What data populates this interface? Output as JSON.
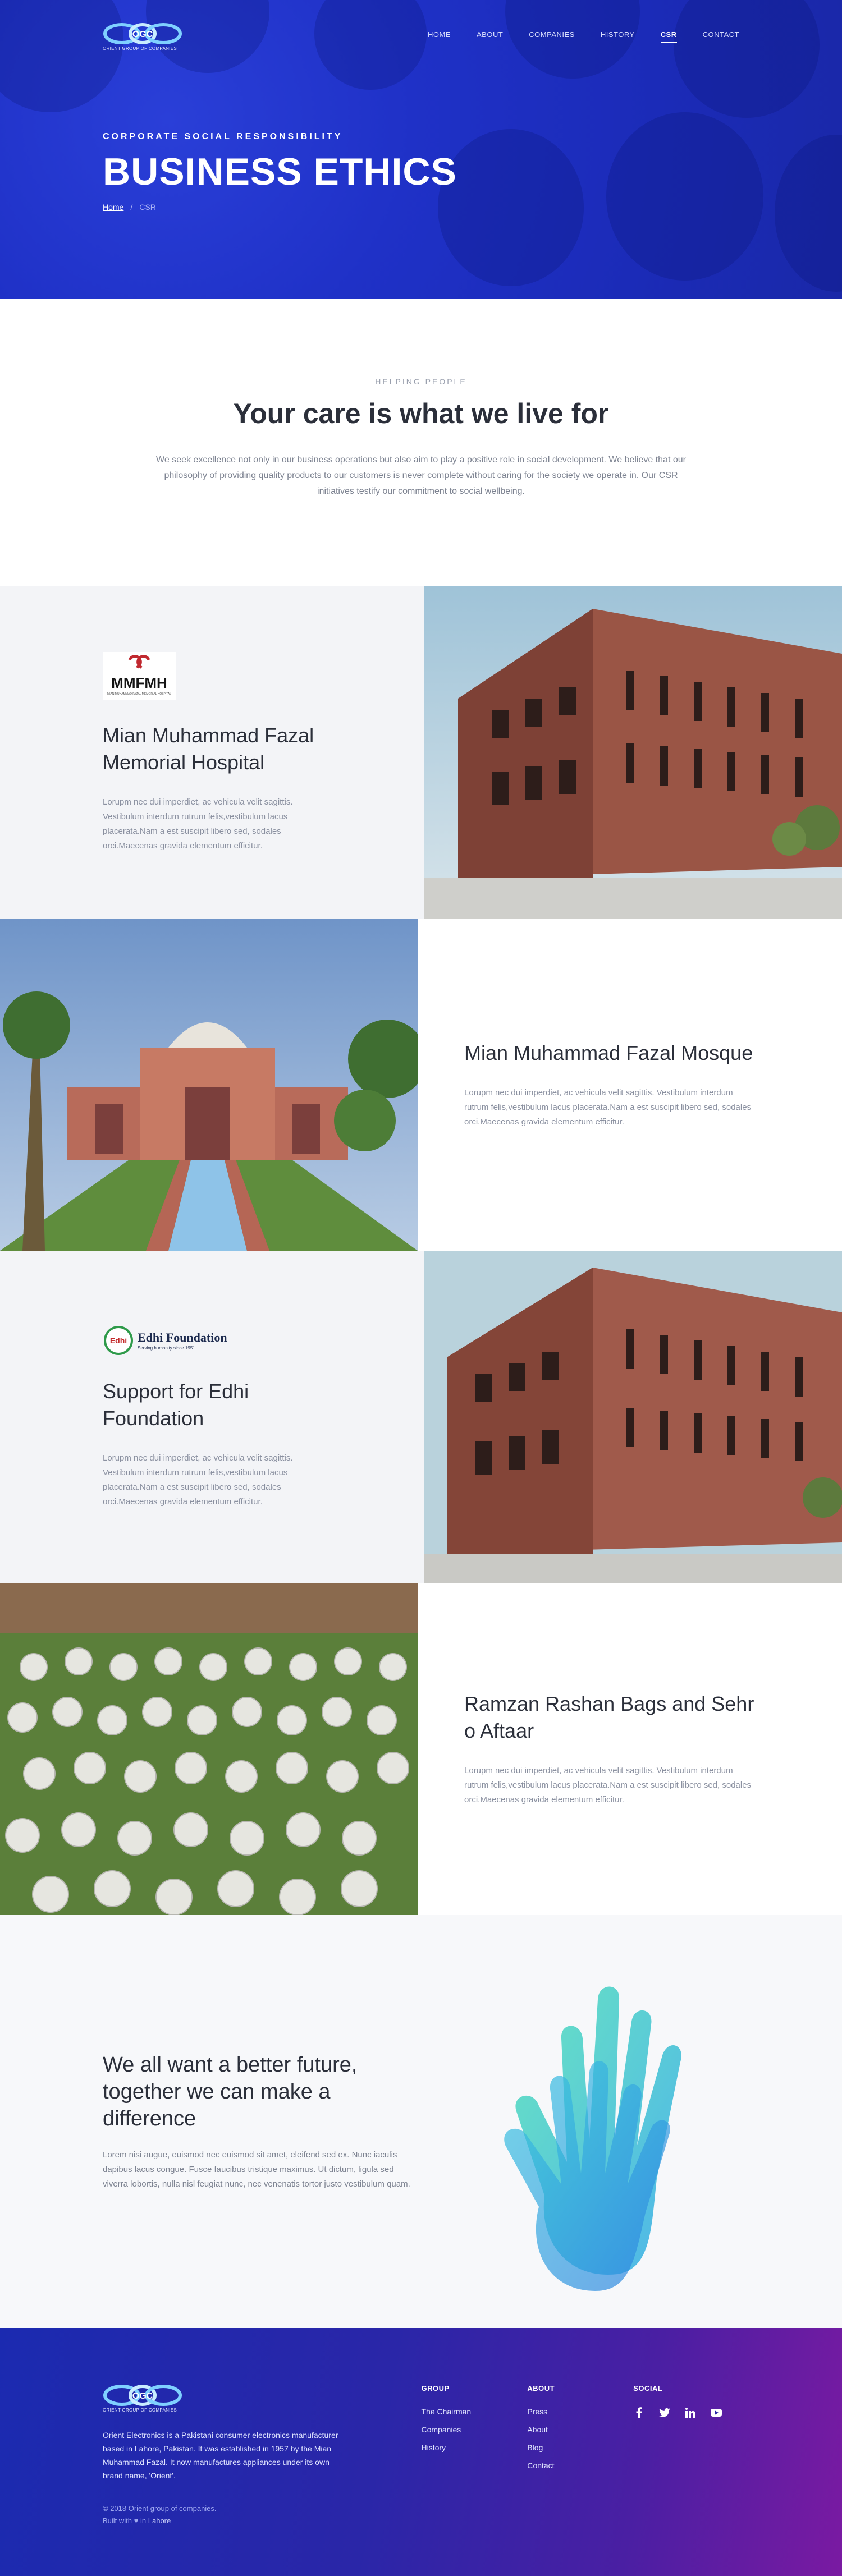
{
  "brand": {
    "logo_text": "OGC",
    "logo_sub": "ORIENT GROUP OF COMPANIES"
  },
  "nav": {
    "links": [
      "HOME",
      "ABOUT",
      "COMPANIES",
      "HISTORY",
      "CSR",
      "CONTACT"
    ],
    "active": "CSR"
  },
  "hero": {
    "eyebrow": "CORPORATE SOCIAL RESPONSIBILITY",
    "title": "BUSINESS ETHICS",
    "breadcrumb_home": "Home",
    "breadcrumb_sep": "/",
    "breadcrumb_current": "CSR"
  },
  "intro": {
    "kicker": "HELPING PEOPLE",
    "title": "Your care is what we live for",
    "body": "We seek excellence not only in our business operations but also aim to play a positive role in social development. We believe that our philosophy of providing quality products to our customers is never complete without caring for the society we operate in. Our CSR initiatives testify our commitment to social wellbeing."
  },
  "initiatives": [
    {
      "title": "Mian Muhammad Fazal Memorial Hospital",
      "body": "Lorupm nec dui imperdiet, ac vehicula velit sagittis. Vestibulum interdum rutrum felis,vestibulum lacus placerata.Nam a est suscipit libero sed, sodales orci.Maecenas gravida elementum efficitur.",
      "logo_text": "MMFMH",
      "logo_sub": "MIAN MUHAMMAD FAZAL MEMORIAL HOSPITAL"
    },
    {
      "title": "Mian Muhammad Fazal Mosque",
      "body": "Lorupm nec dui imperdiet, ac vehicula velit sagittis. Vestibulum interdum rutrum felis,vestibulum lacus placerata.Nam a est suscipit libero sed, sodales orci.Maecenas gravida elementum efficitur."
    },
    {
      "title": "Support for Edhi Foundation",
      "body": "Lorupm nec dui imperdiet, ac vehicula velit sagittis. Vestibulum interdum rutrum felis,vestibulum lacus placerata.Nam a est suscipit libero sed, sodales orci.Maecenas gravida elementum efficitur.",
      "logo_text": "Edhi Foundation",
      "logo_sub": "Serving humanity since 1951"
    },
    {
      "title": "Ramzan Rashan Bags and Sehr o Aftaar",
      "body": "Lorupm nec dui imperdiet, ac vehicula velit sagittis. Vestibulum interdum rutrum felis,vestibulum lacus placerata.Nam a est suscipit libero sed, sodales orci.Maecenas gravida elementum efficitur."
    }
  ],
  "values": {
    "title": "We all want a better future, together we can make a difference",
    "body": "Lorem nisi augue, euismod nec euismod sit amet, eleifend sed ex. Nunc iaculis dapibus lacus congue. Fusce faucibus tristique maximus. Ut dictum, ligula sed viverra lobortis, nulla nisl feugiat nunc, nec venenatis tortor justo vestibulum quam."
  },
  "footer": {
    "description": "Orient Electronics is a Pakistani consumer electronics manufacturer based in Lahore, Pakistan. It was established in 1957 by the Mian Muhammad Fazal. It now manufactures appliances under its own brand name, 'Orient'.",
    "copyright": "© 2018 Orient group of companies.",
    "built_prefix": "Built with",
    "built_heart": "♥",
    "built_in": "in",
    "built_city": "Lahore",
    "group_heading": "GROUP",
    "group_links": [
      "The Chairman",
      "Companies",
      "History"
    ],
    "about_heading": "ABOUT",
    "about_links": [
      "Press",
      "About",
      "Blog",
      "Contact"
    ],
    "social_heading": "SOCIAL",
    "social_icons": [
      "facebook-icon",
      "twitter-icon",
      "linkedin-icon",
      "youtube-icon"
    ]
  },
  "colors": {
    "hero_blue": "#1f31c7",
    "panel_gray": "#f3f4f7",
    "text_dark": "#2b2f3a",
    "text_muted": "#8a90a0",
    "footer_start": "#1b2ab0",
    "footer_end": "#7a1aa2"
  }
}
